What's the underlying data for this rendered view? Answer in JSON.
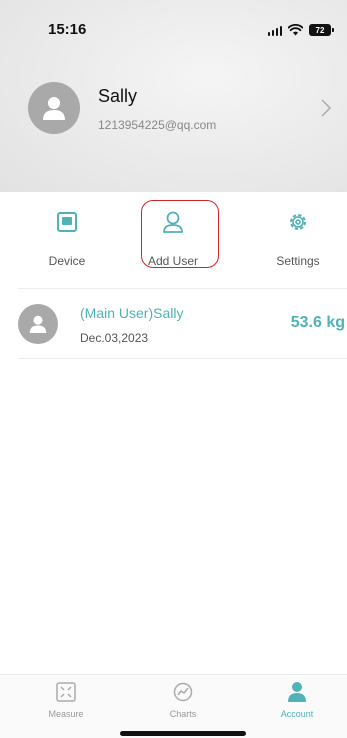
{
  "status_bar": {
    "time": "15:16",
    "battery": "72"
  },
  "profile": {
    "name": "Sally",
    "email": "1213954225@qq.com"
  },
  "actions": [
    {
      "label": "Device",
      "icon": "device-icon"
    },
    {
      "label": "Add User",
      "icon": "add-user-icon"
    },
    {
      "label": "Settings",
      "icon": "gear-icon"
    }
  ],
  "users": [
    {
      "title": "(Main User)Sally",
      "date": "Dec.03,2023",
      "weight": "53.6 kg"
    }
  ],
  "tabs": [
    {
      "label": "Measure",
      "icon": "measure-icon",
      "active": false
    },
    {
      "label": "Charts",
      "icon": "charts-icon",
      "active": false
    },
    {
      "label": "Account",
      "icon": "account-icon",
      "active": true
    }
  ],
  "colors": {
    "accent": "#4fb2b6",
    "highlight": "#d0242b",
    "avatar": "#a9a9a9"
  }
}
